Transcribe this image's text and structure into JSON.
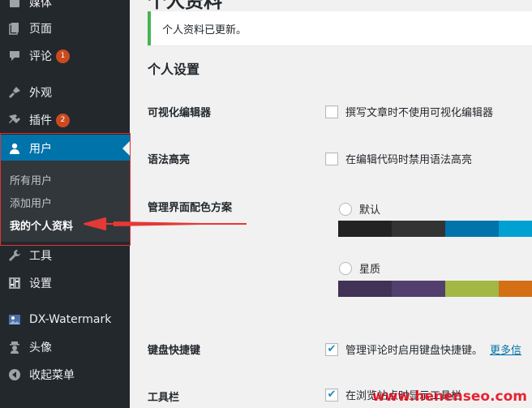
{
  "sidebar": {
    "items": [
      {
        "label": "媒体",
        "icon": "media-icon"
      },
      {
        "label": "页面",
        "icon": "page-icon"
      },
      {
        "label": "评论",
        "icon": "comment-icon",
        "badge": "1"
      },
      {
        "label": "外观",
        "icon": "appearance-icon"
      },
      {
        "label": "插件",
        "icon": "plugin-icon",
        "badge": "2"
      },
      {
        "label": "用户",
        "icon": "user-icon"
      },
      {
        "label": "工具",
        "icon": "tools-icon"
      },
      {
        "label": "设置",
        "icon": "settings-icon"
      },
      {
        "label": "DX-Watermark",
        "icon": "watermark-icon"
      },
      {
        "label": "头像",
        "icon": "avatar-icon"
      },
      {
        "label": "收起菜单",
        "icon": "collapse-icon"
      }
    ],
    "submenu": [
      "所有用户",
      "添加用户",
      "我的个人资料"
    ]
  },
  "page": {
    "title": "个人资料",
    "notice": "个人资料已更新。",
    "section_title": "个人设置"
  },
  "settings": {
    "visual_editor": {
      "label": "可视化编辑器",
      "option": "撰写文章时不使用可视化编辑器",
      "checked": false
    },
    "syntax": {
      "label": "语法高亮",
      "option": "在编辑代码时禁用语法高亮",
      "checked": false
    },
    "color_scheme": {
      "label": "管理界面配色方案",
      "schemes": [
        {
          "name": "默认",
          "colors": [
            "#222222",
            "#333333",
            "#0073aa",
            "#00a0d2"
          ]
        },
        {
          "name": "星质",
          "colors": [
            "#413256",
            "#523f6d",
            "#a3b745",
            "#d46f15"
          ]
        }
      ]
    },
    "keyboard": {
      "label": "键盘快捷键",
      "option": "管理评论时启用键盘快捷键。",
      "link": "更多信",
      "checked": true
    },
    "toolbar": {
      "label": "工具栏",
      "option": "在浏览站点时显示工具栏",
      "checked": true
    }
  },
  "watermark": "www.henenseo.com",
  "colors": {
    "sidebar_bg": "#23282d",
    "current_bg": "#0073aa",
    "submenu_bg": "#32373c",
    "badge": "#ca4a1f",
    "highlight_box": "#dd3333"
  }
}
